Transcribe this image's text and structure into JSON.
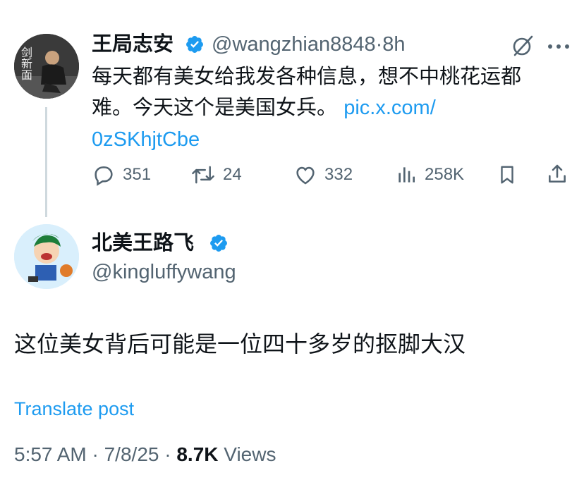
{
  "tweet": {
    "author_name": "王局志安",
    "author_handle": "@wangzhian8848",
    "separator": "·",
    "time_ago": "8h",
    "text_line1": "每天都有美女给我发各种信息，想不中桃花运都",
    "text_line2": "难。今天这个是美国女兵。",
    "link_part1": "pic.x.com/",
    "link_part2": "0zSKhjtCbe",
    "replies": "351",
    "reposts": "24",
    "likes": "332",
    "views": "258K",
    "avatar_caption": "剑新面"
  },
  "reply": {
    "author_name": "北美王路飞",
    "author_handle": "@kingluffywang",
    "text": "这位美女背后可能是一位四十多岁的抠脚大汉",
    "translate_label": "Translate post",
    "timestamp": "5:57 AM · 7/8/25 · ",
    "view_count": "8.7K",
    "views_label": " Views"
  },
  "colors": {
    "accent": "#1d9bf0",
    "muted": "#536471",
    "text": "#0f1419",
    "line": "#cfd9de"
  },
  "icons": [
    "verified-badge-icon",
    "grok-icon",
    "more-icon",
    "reply-icon",
    "repost-icon",
    "like-icon",
    "views-icon",
    "bookmark-icon",
    "share-icon"
  ]
}
